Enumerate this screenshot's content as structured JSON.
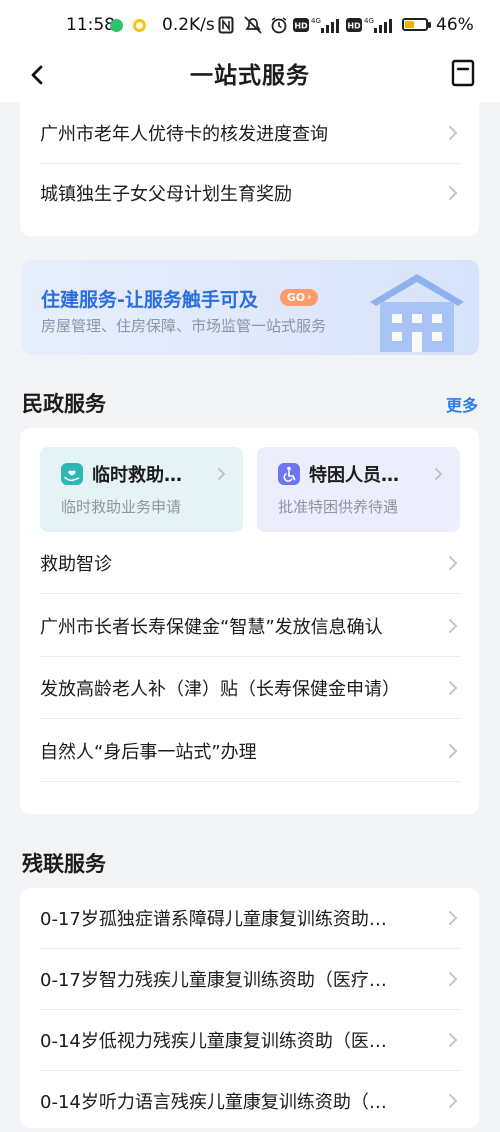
{
  "status_bar": {
    "time": "11:58",
    "speed": "0.2K/s",
    "battery_percent": "46%",
    "battery_level": 0.46,
    "network_labels": [
      "HD",
      "4G",
      "HD",
      "4G"
    ]
  },
  "nav": {
    "title": "一站式服务"
  },
  "top_card": {
    "items": [
      {
        "label": "广州市老年人优待卡的核发进度查询"
      },
      {
        "label": "城镇独生子女父母计划生育奖励"
      }
    ]
  },
  "banner": {
    "title": "住建服务-让服务触手可及",
    "go_label": "GO",
    "subtitle": "房屋管理、住房保障、市场监管一站式服务"
  },
  "civil_section": {
    "title": "民政服务",
    "more_label": "更多",
    "tiles": [
      {
        "title": "临时救助…",
        "subtitle": "临时救助业务申请",
        "icon": "hand-heart-icon",
        "bg_color": "#e5f3f6",
        "icon_color": "#2fb8b3"
      },
      {
        "title": "特困人员…",
        "subtitle": "批准特困供养待遇",
        "icon": "wheelchair-icon",
        "bg_color": "#eceefb",
        "icon_color": "#6f74f2"
      }
    ],
    "items": [
      {
        "label": "救助智诊"
      },
      {
        "label": "广州市长者长寿保健金“智慧”发放信息确认"
      },
      {
        "label": "发放高龄老人补（津）贴（长寿保健金申请）"
      },
      {
        "label": "自然人“身后事一站式”办理"
      }
    ]
  },
  "disabled_section": {
    "title": "残联服务",
    "items": [
      {
        "label": "0-17岁孤独症谱系障碍儿童康复训练资助…"
      },
      {
        "label": "0-17岁智力残疾儿童康复训练资助（医疗…"
      },
      {
        "label": "0-14岁低视力残疾儿童康复训练资助（医…"
      },
      {
        "label": "0-14岁听力语言残疾儿童康复训练资助（…"
      }
    ]
  },
  "colors": {
    "accent_blue": "#2b7df0",
    "banner_title": "#2b6de0",
    "go_badge": "#ff9a6a",
    "battery": "#f4b000"
  }
}
